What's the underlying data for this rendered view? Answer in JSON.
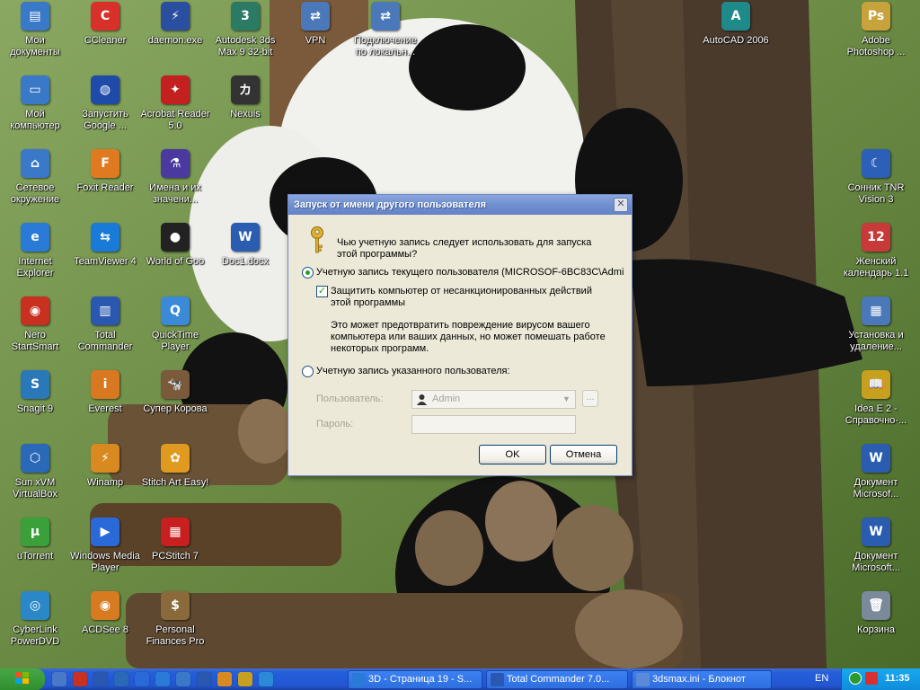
{
  "desktop": {
    "icons": [
      {
        "label": "Мои документы",
        "icon": "my-documents-icon",
        "color": "#3a78c8",
        "glyph": "▤"
      },
      {
        "label": "CCleaner",
        "icon": "ccleaner-icon",
        "color": "#d8312a",
        "glyph": "C"
      },
      {
        "label": "daemon.exe",
        "icon": "daemon-tools-icon",
        "color": "#2a4ea0",
        "glyph": "⚡"
      },
      {
        "label": "Autodesk 3ds Max 9 32-bit",
        "icon": "3ds-max-icon",
        "color": "#2b7a63",
        "glyph": "3"
      },
      {
        "label": "VPN",
        "icon": "vpn-icon",
        "color": "#4b78b8",
        "glyph": "⇄"
      },
      {
        "label": "Подключение по локальн...",
        "icon": "network-connection-icon",
        "color": "#4b78b8",
        "glyph": "⇄"
      },
      {
        "label": "AutoCAD 2006",
        "icon": "autocad-icon",
        "color": "#1f8a8a",
        "glyph": "A"
      },
      {
        "label": "Adobe Photoshop ...",
        "icon": "photoshop-icon",
        "color": "#c8a23a",
        "glyph": "Ps"
      },
      {
        "label": "Мой компьютер",
        "icon": "my-computer-icon",
        "color": "#3a78c8",
        "glyph": "▭"
      },
      {
        "label": "Запустить Google ...",
        "icon": "google-earth-icon",
        "color": "#1e4ba8",
        "glyph": "◍"
      },
      {
        "label": "Acrobat Reader 5.0",
        "icon": "acrobat-reader-icon",
        "color": "#c42020",
        "glyph": "✦"
      },
      {
        "label": "Nexuis",
        "icon": "nexuis-icon",
        "color": "#333333",
        "glyph": "カ"
      },
      {
        "label": "Сетевое окружение",
        "icon": "network-places-icon",
        "color": "#3a78c8",
        "glyph": "⌂"
      },
      {
        "label": "Foxit Reader",
        "icon": "foxit-reader-icon",
        "color": "#e07a20",
        "glyph": "F"
      },
      {
        "label": "Имена и их значени...",
        "icon": "names-app-icon",
        "color": "#4a3aa0",
        "glyph": "⚗"
      },
      {
        "label": "Сонник TNR Vision 3",
        "icon": "sonnik-icon",
        "color": "#2b5fb8",
        "glyph": "☾"
      },
      {
        "label": "Internet Explorer",
        "icon": "internet-explorer-icon",
        "color": "#2a7ad8",
        "glyph": "e"
      },
      {
        "label": "TeamViewer 4",
        "icon": "teamviewer-icon",
        "color": "#1a7ad8",
        "glyph": "⇆"
      },
      {
        "label": "World of Goo",
        "icon": "world-of-goo-icon",
        "color": "#222222",
        "glyph": "●"
      },
      {
        "label": "Doc1.docx",
        "icon": "word-document-icon",
        "color": "#2a5cb0",
        "glyph": "W"
      },
      {
        "label": "Женский календарь 1.1",
        "icon": "calendar-icon",
        "color": "#c83a3a",
        "glyph": "12"
      },
      {
        "label": "Nero StartSmart",
        "icon": "nero-icon",
        "color": "#c83020",
        "glyph": "◉"
      },
      {
        "label": "Total Commander",
        "icon": "total-commander-icon",
        "color": "#2a58b0",
        "glyph": "▥"
      },
      {
        "label": "QuickTime Player",
        "icon": "quicktime-icon",
        "color": "#3a8ad8",
        "glyph": "Q"
      },
      {
        "label": "Установка и удаление...",
        "icon": "add-remove-programs-icon",
        "color": "#4a78b8",
        "glyph": "▦"
      },
      {
        "label": "Snagit 9",
        "icon": "snagit-icon",
        "color": "#2a78b8",
        "glyph": "S"
      },
      {
        "label": "Everest",
        "icon": "everest-icon",
        "color": "#d87820",
        "glyph": "i"
      },
      {
        "label": "Супер Корова",
        "icon": "super-cow-icon",
        "color": "#7a5a3a",
        "glyph": "🐄"
      },
      {
        "label": "Idea E 2 - Справочно-...",
        "icon": "idea-book-icon",
        "color": "#c8a020",
        "glyph": "📖"
      },
      {
        "label": "Sun xVM VirtualBox",
        "icon": "virtualbox-icon",
        "color": "#2a68b8",
        "glyph": "⬡"
      },
      {
        "label": "Winamp",
        "icon": "winamp-icon",
        "color": "#d88a20",
        "glyph": "⚡"
      },
      {
        "label": "Stitch Art Easy!",
        "icon": "stitch-art-icon",
        "color": "#e09a20",
        "glyph": "✿"
      },
      {
        "label": "Документ Microsof...",
        "icon": "word-document-icon",
        "color": "#2a5cb0",
        "glyph": "W"
      },
      {
        "label": "uTorrent",
        "icon": "utorrent-icon",
        "color": "#3aa03a",
        "glyph": "µ"
      },
      {
        "label": "Windows Media Player",
        "icon": "media-player-icon",
        "color": "#2a6ad8",
        "glyph": "▶"
      },
      {
        "label": "PCStitch 7",
        "icon": "pcstitch-icon",
        "color": "#c82020",
        "glyph": "▦"
      },
      {
        "label": "Документ Microsoft...",
        "icon": "word-document-icon",
        "color": "#2a5cb0",
        "glyph": "W"
      },
      {
        "label": "CyberLink PowerDVD",
        "icon": "powerdvd-icon",
        "color": "#2a88c8",
        "glyph": "◎"
      },
      {
        "label": "ACDSee 8",
        "icon": "acdsee-icon",
        "color": "#d87a20",
        "glyph": "◉"
      },
      {
        "label": "Personal Finances Pro",
        "icon": "personal-finances-icon",
        "color": "#8a6a3a",
        "glyph": "$"
      },
      {
        "label": "Корзина",
        "icon": "recycle-bin-icon",
        "color": "#7a8a9a",
        "glyph": "🗑"
      }
    ]
  },
  "dialog": {
    "title": "Запуск от имени другого пользователя",
    "question": "Чью учетную запись следует использовать для запуска этой программы?",
    "current_user_option": "Учетную запись текущего пользователя (MICROSOF-6BC83C\\Admi",
    "protect_checkbox": "Защитить компьютер от несанкционированных действий этой программы",
    "protect_note": "Это может предотвратить повреждение вирусом вашего компьютера или ваших данных, но может помешать работе некоторых программ.",
    "specified_user_option": "Учетную запись указанного пользователя:",
    "user_label": "Пользователь:",
    "user_value": "Admin",
    "browse_button": "...",
    "password_label": "Пароль:",
    "password_value": "",
    "ok_button": "OK",
    "cancel_button": "Отмена",
    "close_button": "✕"
  },
  "taskbar": {
    "tasks": [
      {
        "label": "3D - Страница 19 - S...",
        "icon": "internet-explorer-icon",
        "color": "#2a7ad8"
      },
      {
        "label": "Total Commander 7.0...",
        "icon": "total-commander-icon",
        "color": "#2a58b0"
      },
      {
        "label": "3dsmax.ini - Блокнот",
        "icon": "notepad-icon",
        "color": "#5a8ad8"
      }
    ],
    "language": "EN",
    "clock": "11:35",
    "quick_launch": [
      {
        "icon": "show-desktop-icon",
        "color": "#4a78c8"
      },
      {
        "icon": "nero-icon",
        "color": "#c83020"
      },
      {
        "icon": "total-commander-icon",
        "color": "#2a58b0"
      },
      {
        "icon": "virtualbox-icon",
        "color": "#2a68b8"
      },
      {
        "icon": "media-player-icon",
        "color": "#2a6ad8"
      },
      {
        "icon": "internet-explorer-icon",
        "color": "#2a7ad8"
      },
      {
        "icon": "my-computer-icon",
        "color": "#3a78c8"
      },
      {
        "icon": "save-icon",
        "color": "#2a58b0"
      },
      {
        "icon": "winamp-icon",
        "color": "#d88a20"
      },
      {
        "icon": "daemon-tools-icon",
        "color": "#c8a020"
      },
      {
        "icon": "search-icon",
        "color": "#2a8ad8"
      }
    ]
  }
}
